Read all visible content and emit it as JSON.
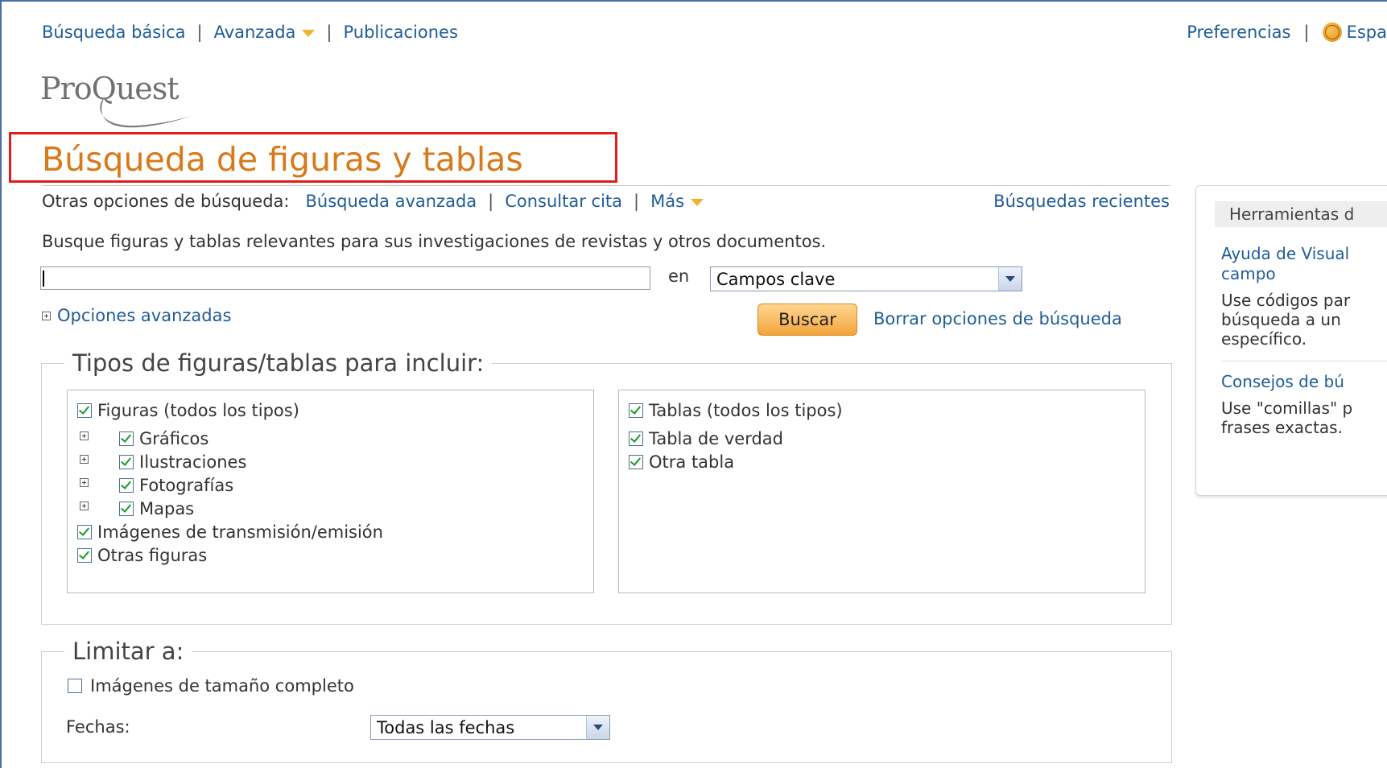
{
  "top_nav": {
    "basic": "Búsqueda básica",
    "advanced": "Avanzada",
    "publications": "Publicaciones",
    "sep": "|"
  },
  "top_right": {
    "preferences": "Preferencias",
    "language": "Espa"
  },
  "logo": {
    "text": "ProQuest"
  },
  "page_title": "Búsqueda de figuras y tablas",
  "other_options": {
    "label": "Otras opciones de búsqueda:",
    "advanced_search": "Búsqueda avanzada",
    "cite": "Consultar cita",
    "more": "Más",
    "recent": "Búsquedas recientes"
  },
  "description": "Busque figuras y tablas relevantes para sus investigaciones de revistas y otros documentos.",
  "search": {
    "value": "",
    "in_label": "en",
    "field_selected": "Campos clave"
  },
  "advanced_options_label": "Opciones avanzadas",
  "buttons": {
    "search": "Buscar",
    "clear": "Borrar opciones de búsqueda"
  },
  "types_section": {
    "legend": "Tipos de figuras/tablas para incluir:",
    "figures": {
      "all": "Figuras (todos los tipos)",
      "charts": "Gráficos",
      "illustrations": "Ilustraciones",
      "photos": "Fotografías",
      "maps": "Mapas",
      "broadcast": "Imágenes de transmisión/emisión",
      "other": "Otras figuras"
    },
    "tables": {
      "all": "Tablas (todos los tipos)",
      "truth": "Tabla de verdad",
      "other": "Otra tabla"
    }
  },
  "limit_section": {
    "legend": "Limitar a:",
    "full_size": "Imágenes de tamaño completo",
    "dates_label": "Fechas:",
    "dates_selected": "Todas las fechas"
  },
  "side_panel": {
    "header": "Herramientas d",
    "help_link_line1": "Ayuda de Visual",
    "help_link_line2": "campo",
    "help_text_line1": "Use códigos par",
    "help_text_line2": "búsqueda a un ",
    "help_text_line3": "específico.",
    "tips_link": "Consejos de bú",
    "tips_text_line1": "Use \"comillas\" p",
    "tips_text_line2": "frases exactas."
  },
  "colors": {
    "title": "#d8791a",
    "link": "#1f5c99",
    "highlight_box": "#e21b1b",
    "button": "#f2a53b"
  }
}
